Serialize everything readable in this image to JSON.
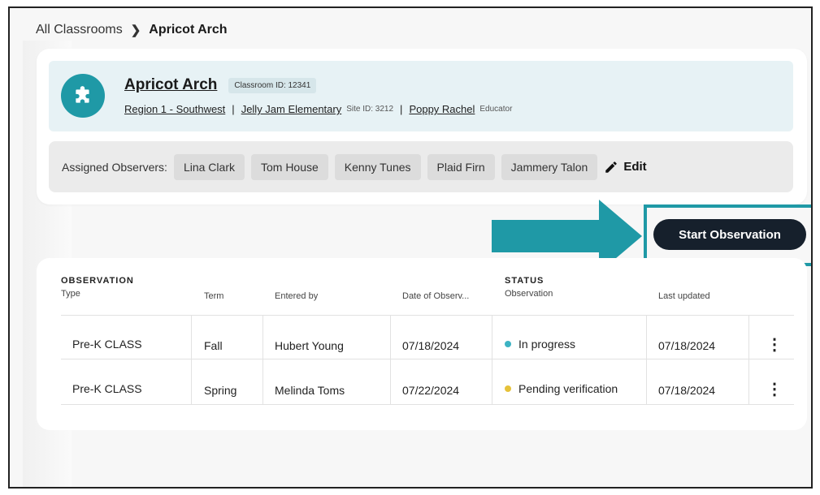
{
  "breadcrumb": {
    "root": "All Classrooms",
    "current": "Apricot Arch"
  },
  "classroom": {
    "name": "Apricot Arch",
    "id_badge": "Classroom ID: 12341",
    "region": "Region 1 - Southwest",
    "school": "Jelly Jam Elementary",
    "site_id": "Site ID: 3212",
    "educator": "Poppy Rachel",
    "educator_role": "Educator",
    "icon": "puzzle-icon"
  },
  "observers": {
    "label": "Assigned Observers:",
    "names": [
      "Lina Clark",
      "Tom House",
      "Kenny Tunes",
      "Plaid Firn",
      "Jammery Talon"
    ],
    "edit_label": "Edit"
  },
  "actions": {
    "start_label": "Start Observation"
  },
  "table": {
    "headers": {
      "observation_caption": "OBSERVATION",
      "type": "Type",
      "term": "Term",
      "entered_by": "Entered by",
      "date": "Date of Observ...",
      "status_caption": "STATUS",
      "status_sub": "Observation",
      "last_updated": "Last updated"
    },
    "rows": [
      {
        "type": "Pre-K CLASS",
        "term": "Fall",
        "entered_by": "Hubert Young",
        "date": "07/18/2024",
        "status": "In progress",
        "status_color": "#3cb3c3",
        "last_updated": "07/18/2024"
      },
      {
        "type": "Pre-K CLASS",
        "term": "Spring",
        "entered_by": "Melinda Toms",
        "date": "07/22/2024",
        "status": "Pending verification",
        "status_color": "#e6c23a",
        "last_updated": "07/18/2024"
      }
    ]
  },
  "colors": {
    "accent": "#1f99a6",
    "button_dark": "#16202c",
    "header_bg": "#e7f2f5"
  }
}
